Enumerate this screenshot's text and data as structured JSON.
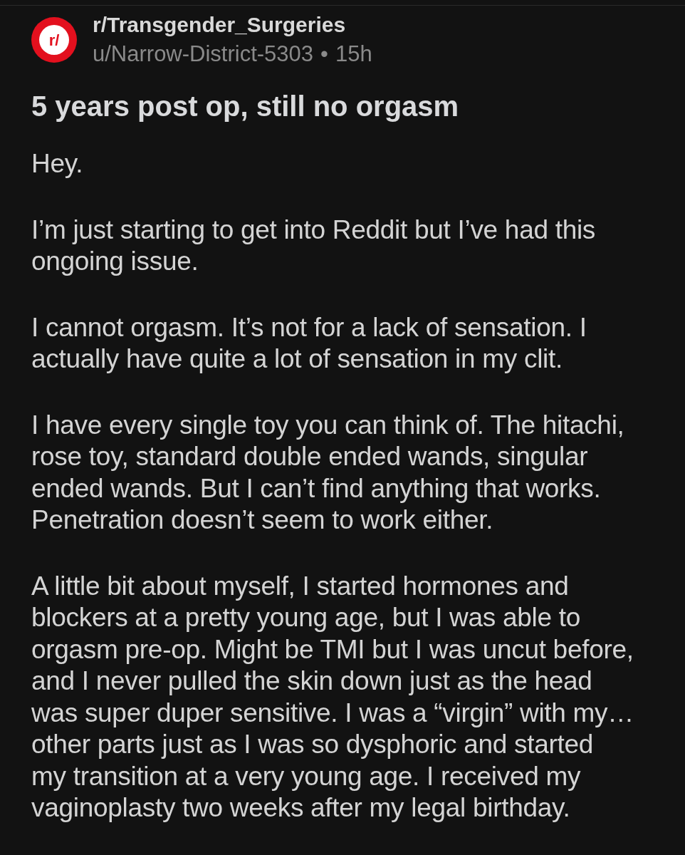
{
  "post": {
    "header": {
      "logo_text": "r/",
      "subreddit": "r/Transgender_Surgeries",
      "author": "u/Narrow-District-5303",
      "separator": "•",
      "age": "15h"
    },
    "title": "5 years post op, still no orgasm",
    "body": [
      "Hey.",
      "I’m just starting to get into Reddit but I’ve had this ongoing issue.",
      "I cannot orgasm. It’s not for a lack of sensation. I actually have quite a lot of sensation in my clit.",
      "I have every single toy you can think of. The hitachi, rose toy, standard double ended wands, singular ended wands. But I can’t find anything that works. Penetration doesn’t seem to work either.",
      "A little bit about myself, I started hormones and blockers at a pretty young age, but I was able to orgasm pre-op. Might be TMI but I was uncut before, and I never pulled the skin down just as the head was super duper sensitive. I was a “virgin” with my… other parts just as I was so dysphoric and started my transition at a very young age. I received my vaginoplasty two weeks after my legal birthday."
    ]
  }
}
